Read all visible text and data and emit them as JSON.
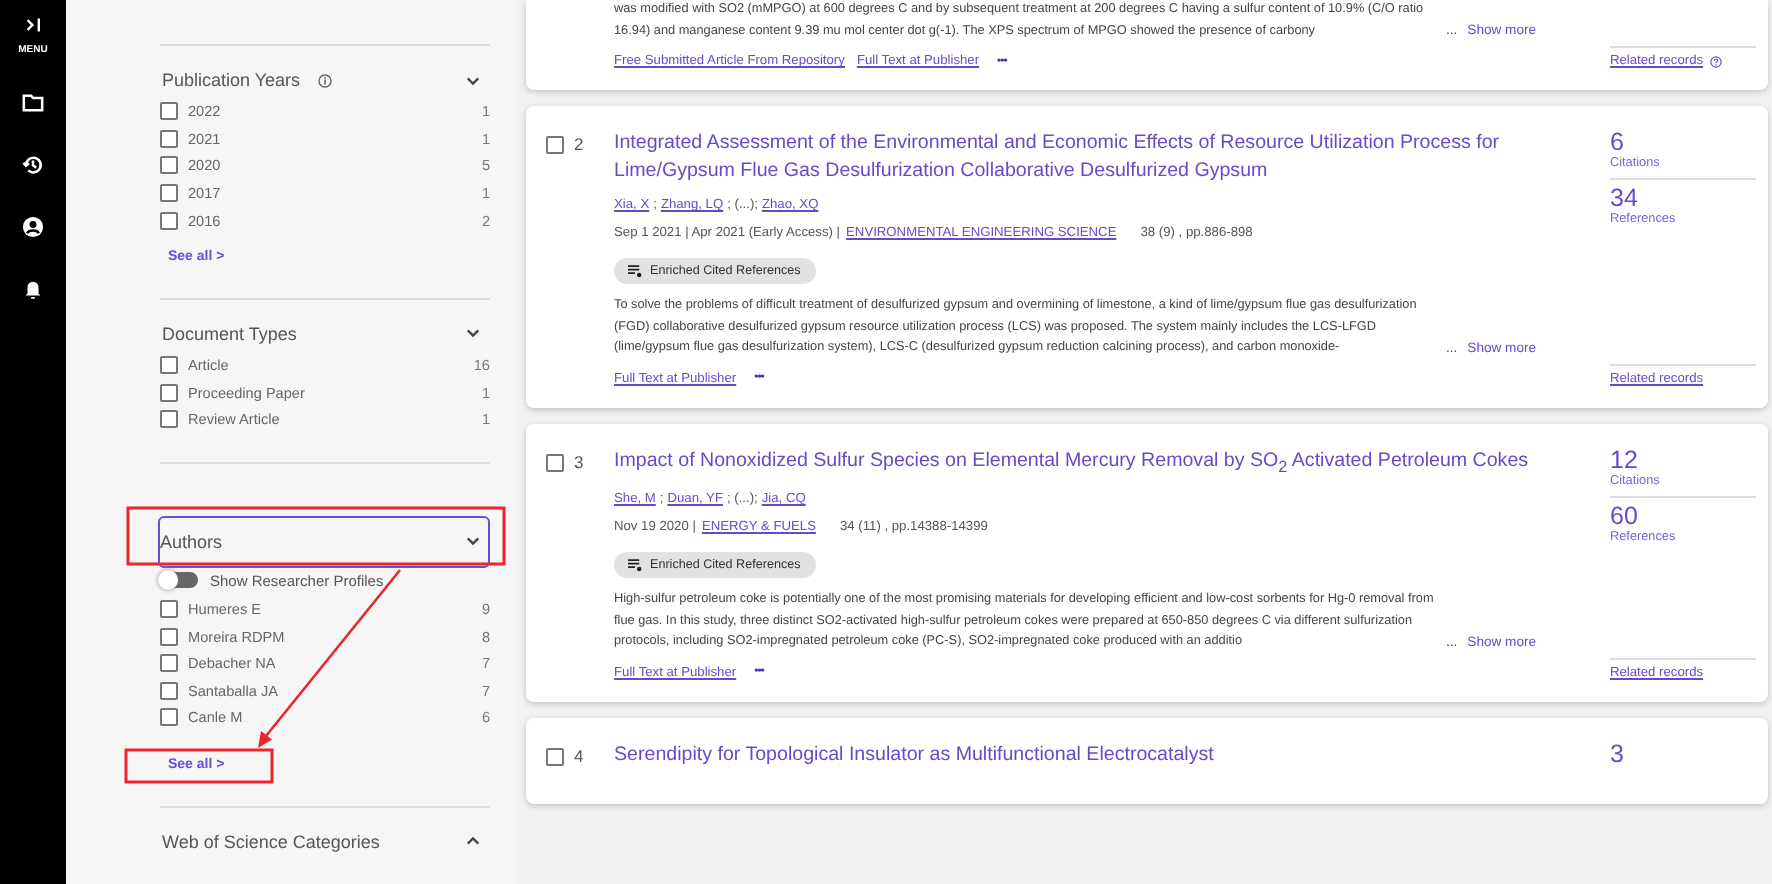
{
  "nav": {
    "expand_label": "MENU"
  },
  "filters": [
    {
      "title": "Publication Years",
      "info": true,
      "expanded": true,
      "focused": false,
      "items": [
        {
          "label": "2022",
          "count": "1",
          "checked": false
        },
        {
          "label": "2021",
          "count": "1",
          "checked": false
        },
        {
          "label": "2020",
          "count": "5",
          "checked": false
        },
        {
          "label": "2017",
          "count": "1",
          "checked": false
        },
        {
          "label": "2016",
          "count": "2",
          "checked": false
        }
      ],
      "see_all": "See all >"
    },
    {
      "title": "Document Types",
      "info": false,
      "expanded": true,
      "focused": false,
      "items": [
        {
          "label": "Article",
          "count": "16",
          "checked": false
        },
        {
          "label": "Proceeding Paper",
          "count": "1",
          "checked": false
        },
        {
          "label": "Review Article",
          "count": "1",
          "checked": false
        }
      ]
    },
    {
      "title": "Authors",
      "info": false,
      "expanded": true,
      "focused": true,
      "toggle": {
        "label": "Show Researcher Profiles",
        "on": false
      },
      "items": [
        {
          "label": "Humeres E",
          "count": "9",
          "checked": false
        },
        {
          "label": "Moreira RDPM",
          "count": "8",
          "checked": false
        },
        {
          "label": "Debacher NA",
          "count": "7",
          "checked": false
        },
        {
          "label": "Santaballa JA",
          "count": "7",
          "checked": false
        },
        {
          "label": "Canle M",
          "count": "6",
          "checked": false
        }
      ],
      "see_all": "See all >"
    },
    {
      "title": "Web of Science Categories",
      "info": false,
      "expanded": false,
      "focused": false
    }
  ],
  "records": [
    {
      "partial": true,
      "abstract": "was modified with SO2 (mMPGO) at 600 degrees C and by subsequent treatment at 200 degrees C having a sulfur content of 10.9% (C/O ratio 16.94) and manganese content 9.39 mu mol center dot g(-1). The XPS spectrum of MPGO showed the presence of carbony",
      "ellipsis": "...",
      "show_more": "Show more",
      "links": [
        "Free Submitted Article From Repository",
        "Full Text at Publisher"
      ],
      "more": "•••",
      "related": "Related records",
      "related_help": true
    },
    {
      "partial": false,
      "number": "2",
      "checked": false,
      "title": "Integrated Assessment of the Environmental and Economic Effects of Resource Utilization Process for Lime/Gypsum Flue Gas Desulfurization Collaborative Desulfurized Gypsum",
      "authors": [
        {
          "kind": "link",
          "text": "Xia, X"
        },
        {
          "kind": "text",
          "text": ";"
        },
        {
          "kind": "link",
          "text": "Zhang, LQ"
        },
        {
          "kind": "text",
          "text": "; (...);"
        },
        {
          "kind": "link",
          "text": "Zhao, XQ"
        }
      ],
      "date": "Sep 1 2021 | Apr 2021 (Early Access) |",
      "journal": "ENVIRONMENTAL ENGINEERING SCIENCE",
      "volume": "38 (9) , pp.886-898",
      "badge": "Enriched Cited References",
      "abstract": "To solve the problems of difficult treatment of desulfurized gypsum and overmining of limestone, a kind of lime/gypsum flue gas desulfurization (FGD) collaborative desulfurized gypsum resource utilization process (LCS) was proposed. The system mainly includes the LCS-LFGD (lime/gypsum flue gas desulfurization system), LCS-C (desulfurized gypsum reduction calcining process), and carbon monoxide-",
      "ellipsis": "...",
      "show_more": "Show more",
      "links": [
        "Full Text at Publisher"
      ],
      "more": "•••",
      "citations": "6",
      "citations_label": "Citations",
      "references": "34",
      "references_label": "References",
      "related": "Related records",
      "related_help": false
    },
    {
      "partial": false,
      "number": "3",
      "checked": false,
      "title": "Impact of Nonoxidized Sulfur Species on Elemental Mercury Removal by SO$_{2}$ Activated Petroleum Cokes",
      "authors": [
        {
          "kind": "link",
          "text": "She, M"
        },
        {
          "kind": "text",
          "text": ";"
        },
        {
          "kind": "link",
          "text": "Duan, YF"
        },
        {
          "kind": "text",
          "text": "; (...);"
        },
        {
          "kind": "link",
          "text": "Jia, CQ"
        }
      ],
      "date": "Nov 19 2020 |",
      "journal": "ENERGY & FUELS",
      "volume": "34 (11) , pp.14388-14399",
      "badge": "Enriched Cited References",
      "abstract": "High-sulfur petroleum coke is potentially one of the most promising materials for developing efficient and low-cost sorbents for Hg-0 removal from flue gas. In this study, three distinct SO2-activated high-sulfur petroleum cokes were prepared at 650-850 degrees C via different sulfurization protocols, including SO2-impregnated petroleum coke (PC-S), SO2-impregnated coke produced with an additio",
      "ellipsis": "...",
      "show_more": "Show more",
      "links": [
        "Full Text at Publisher"
      ],
      "more": "•••",
      "citations": "12",
      "citations_label": "Citations",
      "references": "60",
      "references_label": "References",
      "related": "Related records",
      "related_help": false
    },
    {
      "partial": false,
      "number": "4",
      "checked": false,
      "title": "Serendipity for Topological Insulator as Multifunctional Electrocatalyst",
      "citations": "3"
    }
  ],
  "annotations": [
    {
      "kind": "box"
    },
    {
      "kind": "box"
    },
    {
      "kind": "arrow"
    }
  ]
}
